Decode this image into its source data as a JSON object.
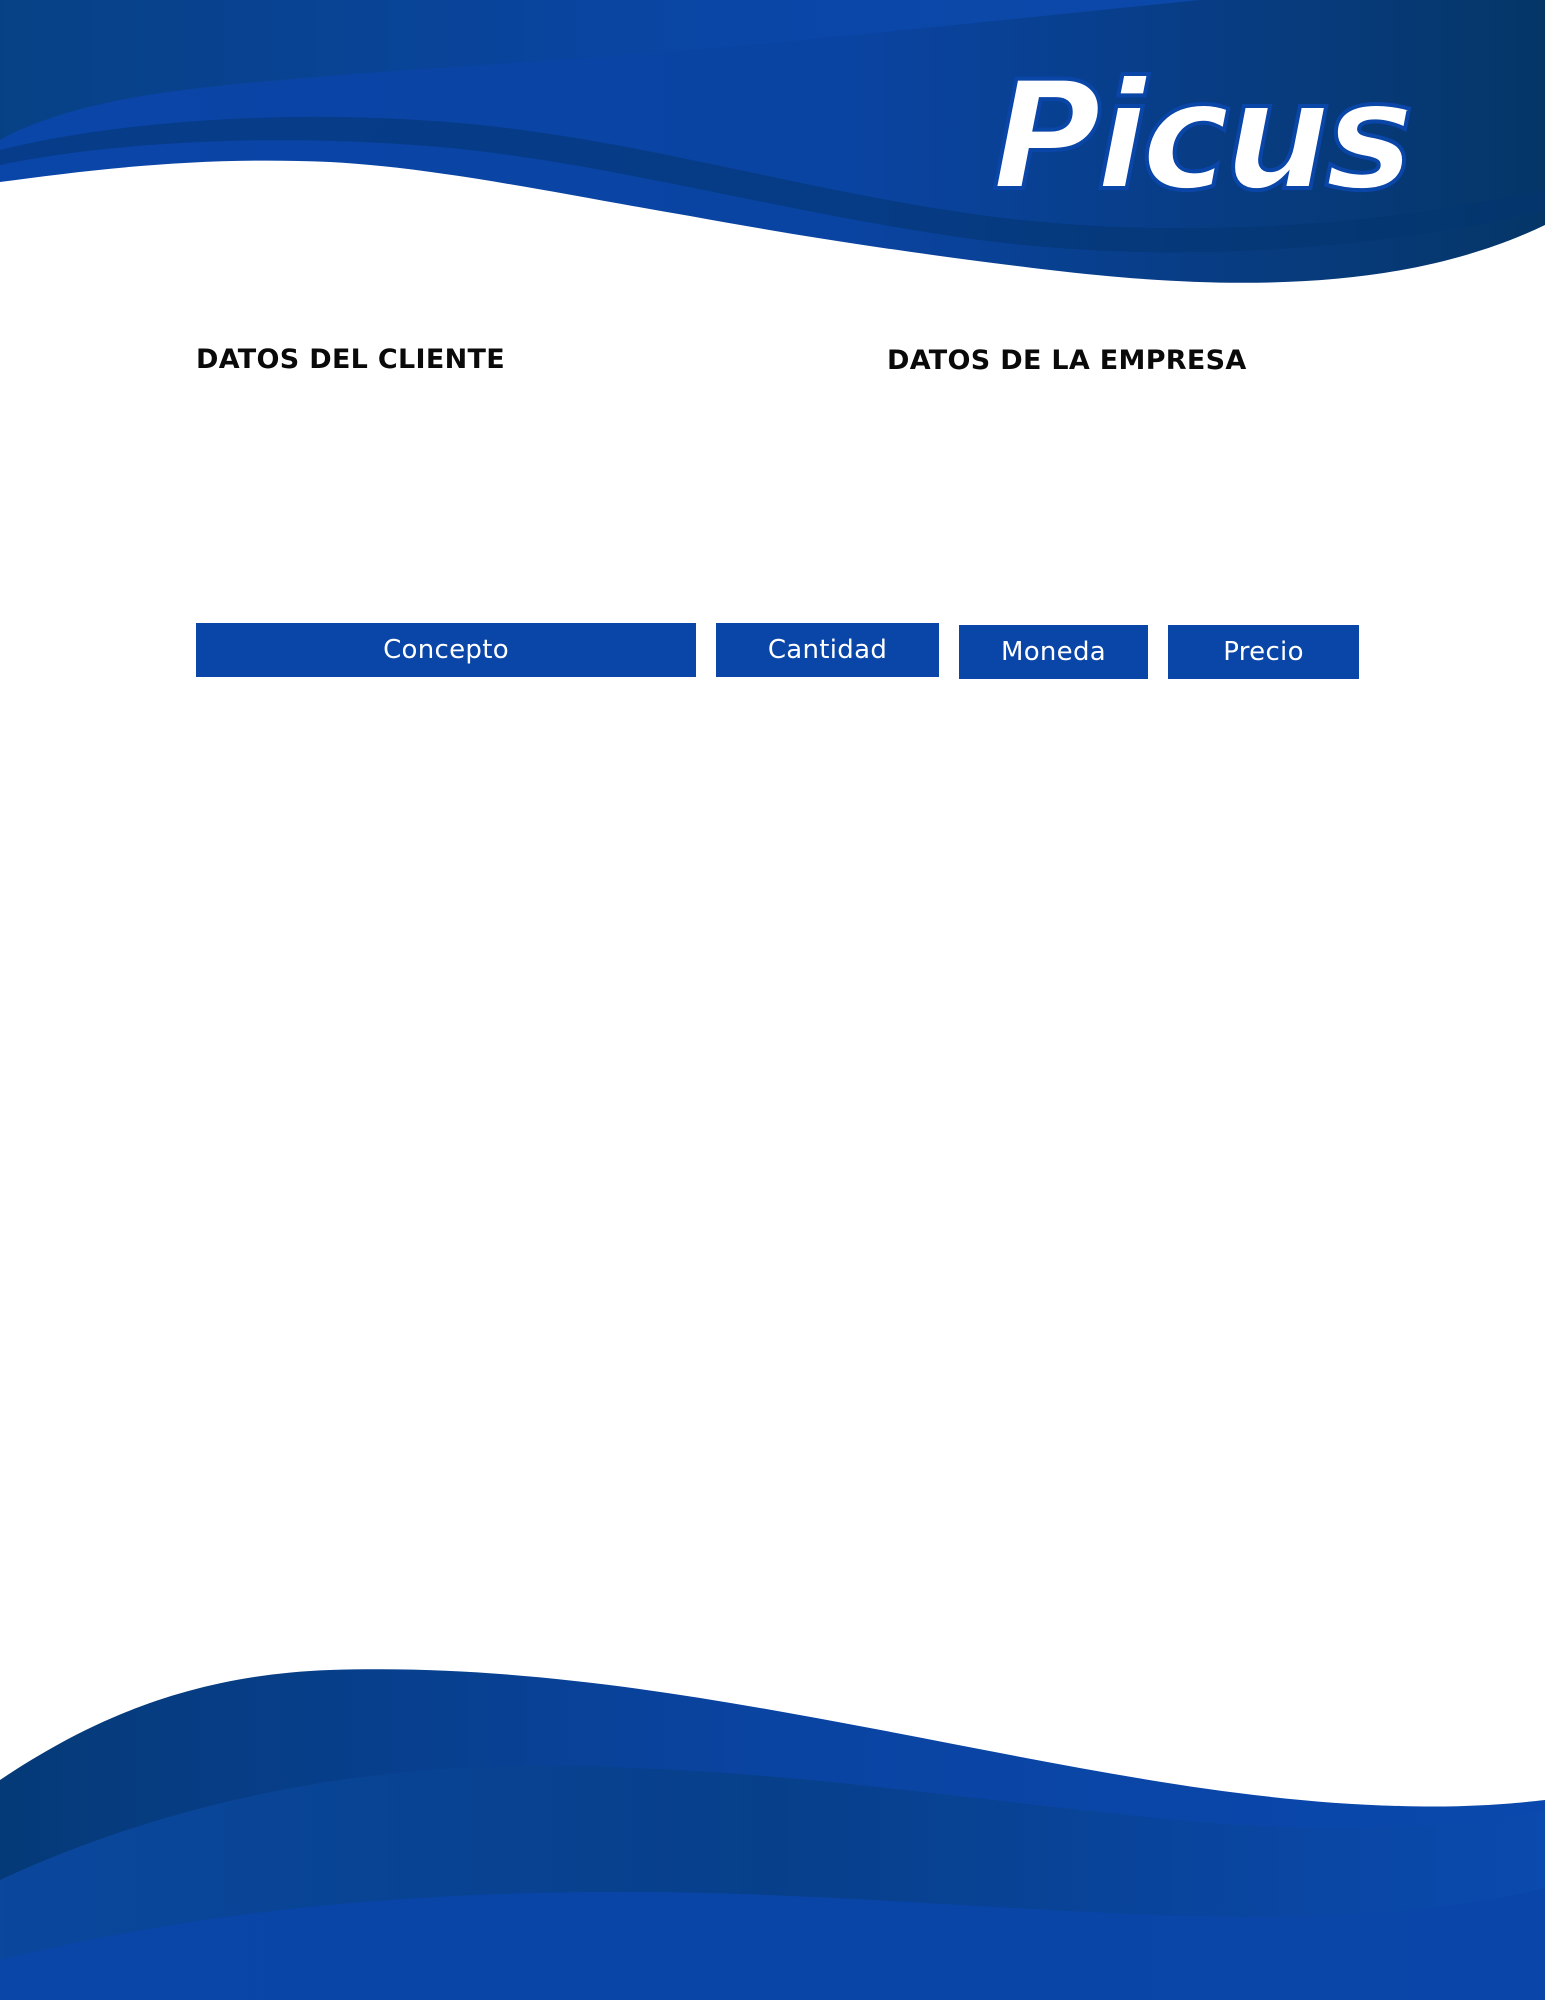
{
  "document": {
    "brand": {
      "logo_text": "Picus",
      "logo_icon": "picus-wordmark-logo"
    },
    "colors": {
      "primary_blue": "#0a45a8",
      "dark_blue": "#053a78",
      "mid_blue": "#0b4aa6",
      "heading_text": "#0a0a0a",
      "header_cell_text": "#ffffff"
    },
    "sections": {
      "client_heading": "DATOS DEL CLIENTE",
      "company_heading": "DATOS DE LA EMPRESA"
    },
    "table": {
      "columns": [
        "Concepto",
        "Cantidad",
        "Moneda",
        "Precio"
      ],
      "rows": []
    }
  }
}
